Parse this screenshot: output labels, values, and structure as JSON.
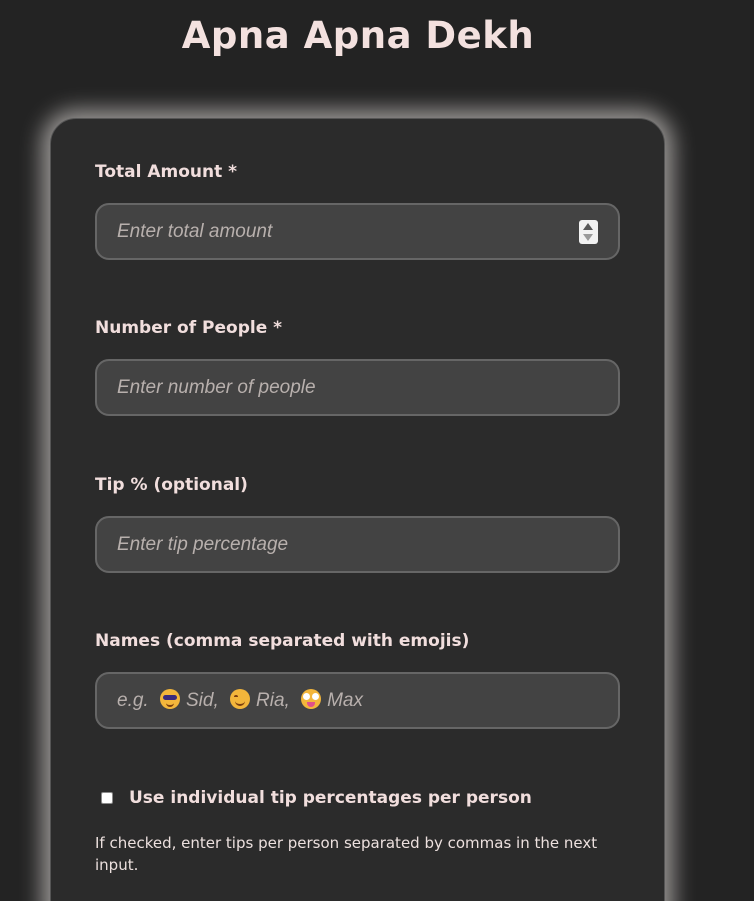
{
  "app": {
    "title": "Apna Apna Dekh"
  },
  "form": {
    "total_amount": {
      "label": "Total Amount *",
      "placeholder": "Enter total amount",
      "value": ""
    },
    "num_people": {
      "label": "Number of People *",
      "placeholder": "Enter number of people",
      "value": ""
    },
    "tip_percent": {
      "label": "Tip % (optional)",
      "placeholder": "Enter tip percentage",
      "value": ""
    },
    "names": {
      "label": "Names (comma separated with emojis)",
      "placeholder_prefix": "e.g.",
      "placeholder_entries": [
        {
          "emoji": "smiling-face-with-sunglasses",
          "name": "Sid,"
        },
        {
          "emoji": "smiling-face",
          "name": "Ria,"
        },
        {
          "emoji": "zany-face",
          "name": "Max"
        }
      ],
      "value": ""
    },
    "individual_tips": {
      "label": "Use individual tip percentages per person",
      "checked": false,
      "hint": "If checked, enter tips per person separated by commas in the next input."
    }
  },
  "colors": {
    "background": "#232323",
    "card": "#2b2b2b",
    "input_bg": "#434343",
    "text": "#f1dedd",
    "placeholder": "#b8b0ad",
    "glow": "#fffaf5"
  }
}
